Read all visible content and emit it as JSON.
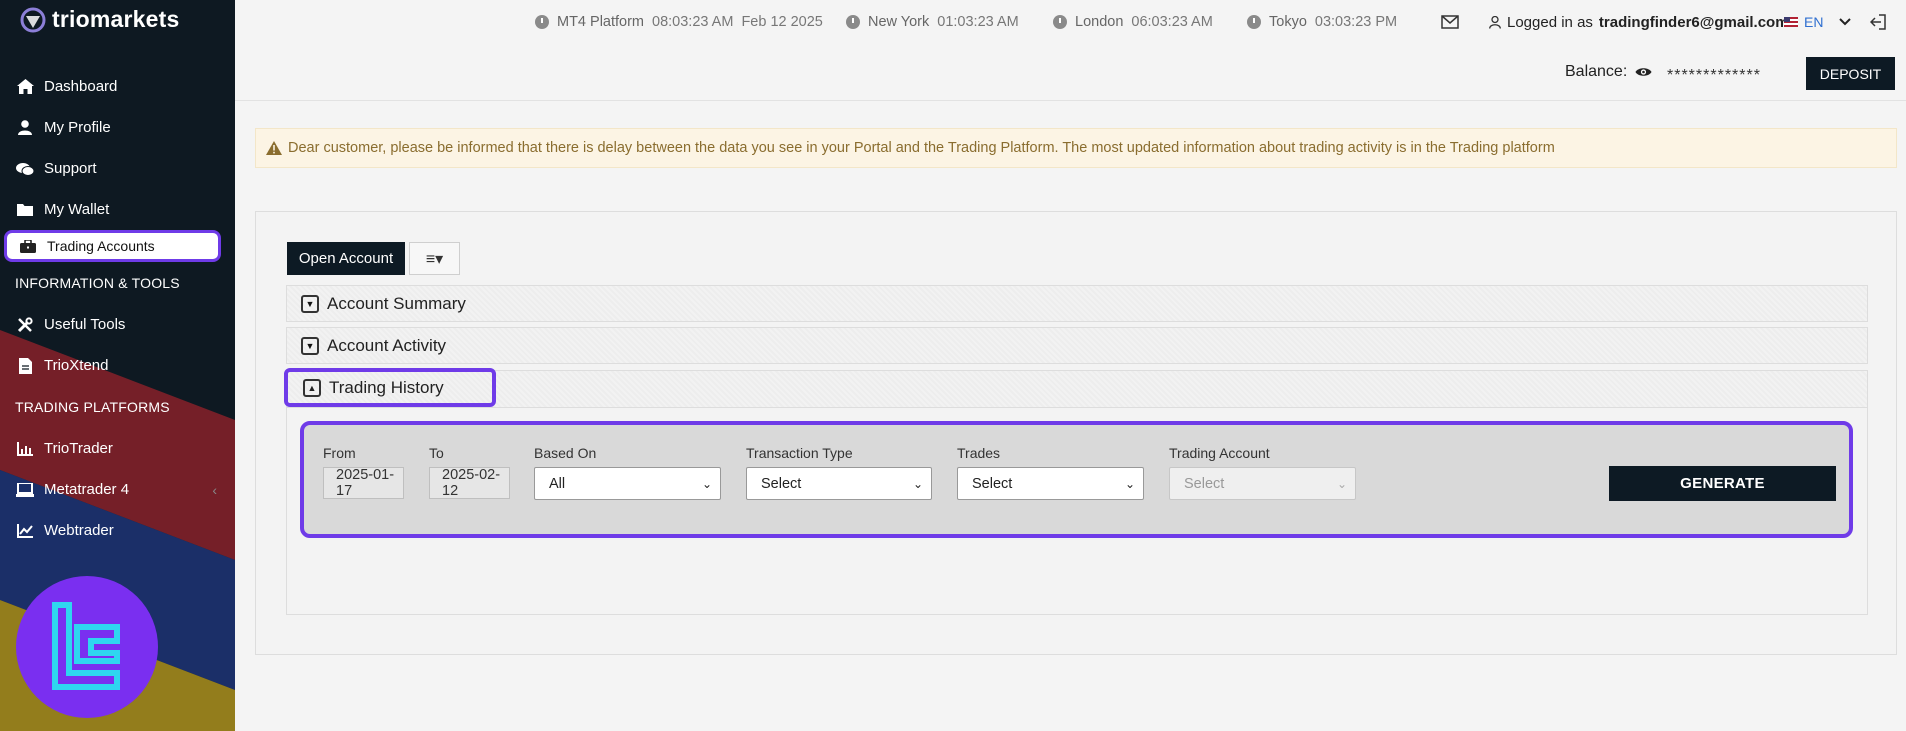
{
  "brand": {
    "name": "triomarkets"
  },
  "sidebar": {
    "items": [
      {
        "label": "Dashboard",
        "icon": "home-icon"
      },
      {
        "label": "My Profile",
        "icon": "user-icon"
      },
      {
        "label": "Support",
        "icon": "chat-icon"
      },
      {
        "label": "My Wallet",
        "icon": "folder-icon"
      },
      {
        "label": "Trading Accounts",
        "icon": "briefcase-icon"
      }
    ],
    "section_info": "INFORMATION & TOOLS",
    "tools": [
      {
        "label": "Useful Tools",
        "icon": "tools-icon"
      },
      {
        "label": "TrioXtend",
        "icon": "file-icon"
      }
    ],
    "section_platforms": "TRADING PLATFORMS",
    "platforms": [
      {
        "label": "TrioTrader",
        "icon": "chart-icon"
      },
      {
        "label": "Metatrader 4",
        "icon": "laptop-icon",
        "chevron": "‹"
      },
      {
        "label": "Webtrader",
        "icon": "line-chart-icon"
      }
    ]
  },
  "topbar": {
    "clocks": [
      {
        "label": "MT4 Platform",
        "time": "08:03:23 AM",
        "date": "Feb 12 2025"
      },
      {
        "label": "New York",
        "time": "01:03:23 AM"
      },
      {
        "label": "London",
        "time": "06:03:23 AM"
      },
      {
        "label": "Tokyo",
        "time": "03:03:23 PM"
      }
    ],
    "logged_in_prefix": "Logged in as",
    "user_email": "tradingfinder6@gmail.com",
    "language": "EN"
  },
  "balance": {
    "label": "Balance:",
    "masked_value": "*************",
    "deposit_label": "DEPOSIT"
  },
  "notice": "Dear customer, please be informed that there is delay between the data you see in your Portal and the Trading Platform. The most updated information about trading activity is in the Trading platform",
  "main": {
    "open_account_label": "Open Account",
    "menu_icon": "≡▾",
    "sections": [
      "Account Summary",
      "Account Activity",
      "Trading History"
    ]
  },
  "filters": {
    "from_label": "From",
    "from_value": "2025-01-17",
    "to_label": "To",
    "to_value": "2025-02-12",
    "based_on_label": "Based On",
    "based_on_value": "All",
    "transaction_type_label": "Transaction Type",
    "transaction_type_value": "Select",
    "trades_label": "Trades",
    "trades_value": "Select",
    "trading_account_label": "Trading Account",
    "trading_account_value": "Select",
    "generate_label": "GENERATE"
  },
  "colors": {
    "accent": "#6f3be8",
    "dark": "#0d1a24",
    "notice_bg": "#fcf4e4"
  }
}
